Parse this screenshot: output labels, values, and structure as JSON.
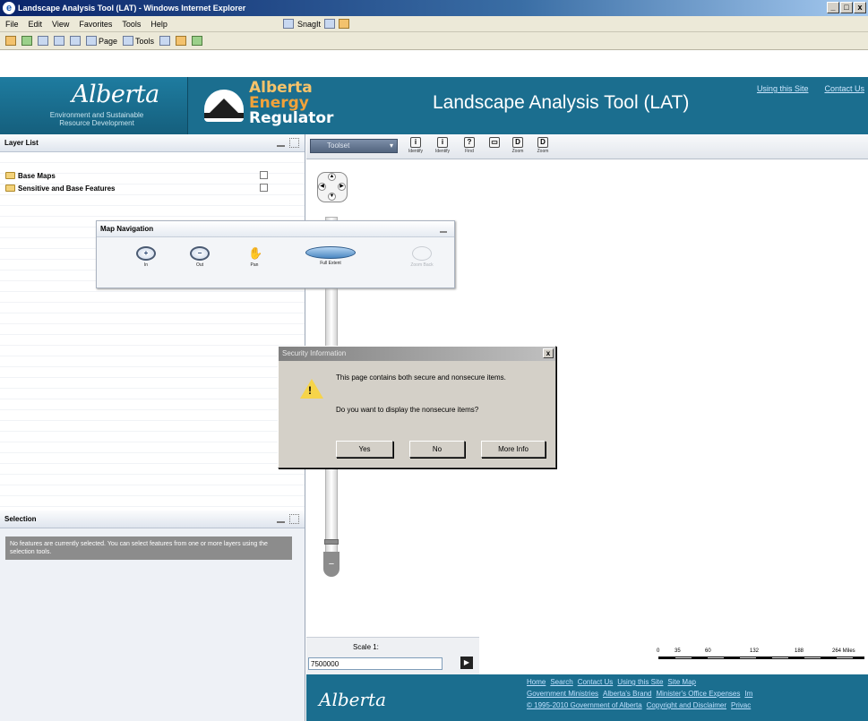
{
  "window": {
    "title": "Landscape Analysis Tool (LAT) - Windows Internet Explorer"
  },
  "menu": {
    "items": [
      "File",
      "Edit",
      "View",
      "Favorites",
      "Tools",
      "Help"
    ],
    "snagit_label": "SnagIt"
  },
  "commandbar": {
    "page_label": "Page",
    "tools_label": "Tools"
  },
  "header": {
    "alberta_logo": "Alberta",
    "env_line1": "Environment and Sustainable",
    "env_line2": "Resource Development",
    "aer_line1": "Alberta",
    "aer_line2": "Energy",
    "aer_line3": "Regulator",
    "app_title": "Landscape Analysis Tool (LAT)",
    "link_using": "Using this Site",
    "link_contact": "Contact Us"
  },
  "layer_list": {
    "title": "Layer List",
    "items": [
      "Base Maps",
      "Sensitive and Base Features"
    ]
  },
  "selection": {
    "title": "Selection",
    "message": "No features are currently selected. You can select features from one or more layers using the selection tools."
  },
  "toolbar": {
    "toolset_label": "Toolset",
    "buttons": [
      "Identify",
      "Identify",
      "Find",
      "",
      "Zoom",
      "Zoom"
    ]
  },
  "map_nav": {
    "title": "Map Navigation",
    "tools": [
      "In",
      "Out",
      "Pan",
      "Full Extent",
      "Zoom Back"
    ]
  },
  "dialog": {
    "title": "Security Information",
    "message1": "This page contains both secure and nonsecure items.",
    "message2": "Do you want to display the nonsecure items?",
    "yes": "Yes",
    "no": "No",
    "more": "More Info",
    "close": "x"
  },
  "scale": {
    "label": "Scale 1:",
    "value": "7500000",
    "ticks": [
      "0",
      "35",
      "60",
      "132",
      "188",
      "264 Miles"
    ]
  },
  "footer": {
    "logo": "Alberta",
    "row1": [
      "Home",
      "Search",
      "Contact Us",
      "Using this Site",
      "Site Map"
    ],
    "row2": [
      "Government Ministries",
      "Alberta's Brand",
      "Minister's Office Expenses",
      "Im"
    ],
    "row3": [
      "© 1995-2010 Government of Alberta",
      "Copyright and Disclaimer",
      "Privac"
    ]
  },
  "colors": {
    "header_teal": "#1b6e8f",
    "dialog_gray": "#d4d0c8"
  }
}
